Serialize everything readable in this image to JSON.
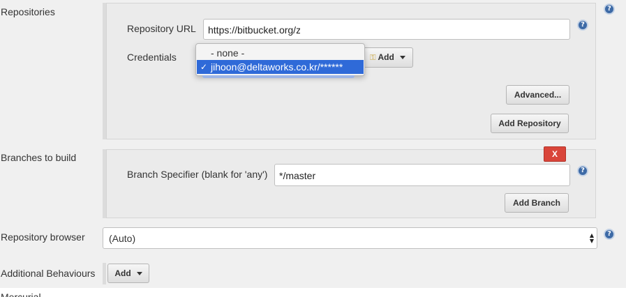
{
  "repositories": {
    "section_label": "Repositories",
    "url_label": "Repository URL",
    "url_value": "https://bitbucket.org/z",
    "credentials_label": "Credentials",
    "credentials_dropdown": {
      "options": [
        {
          "label": "- none -",
          "selected": false
        },
        {
          "label": "jihoon@deltaworks.co.kr/******",
          "selected": true,
          "check": "✓"
        }
      ]
    },
    "add_label": "Add",
    "advanced_label": "Advanced...",
    "add_repository_label": "Add Repository"
  },
  "branches": {
    "section_label": "Branches to build",
    "delete_label": "X",
    "specifier_label": "Branch Specifier (blank for 'any')",
    "specifier_value": "*/master",
    "add_branch_label": "Add Branch"
  },
  "repository_browser": {
    "label": "Repository browser",
    "selected": "(Auto)"
  },
  "additional_behaviours": {
    "label": "Additional Behaviours",
    "add_label": "Add"
  },
  "next_section_label": "Mercurial",
  "help_glyph": "?"
}
